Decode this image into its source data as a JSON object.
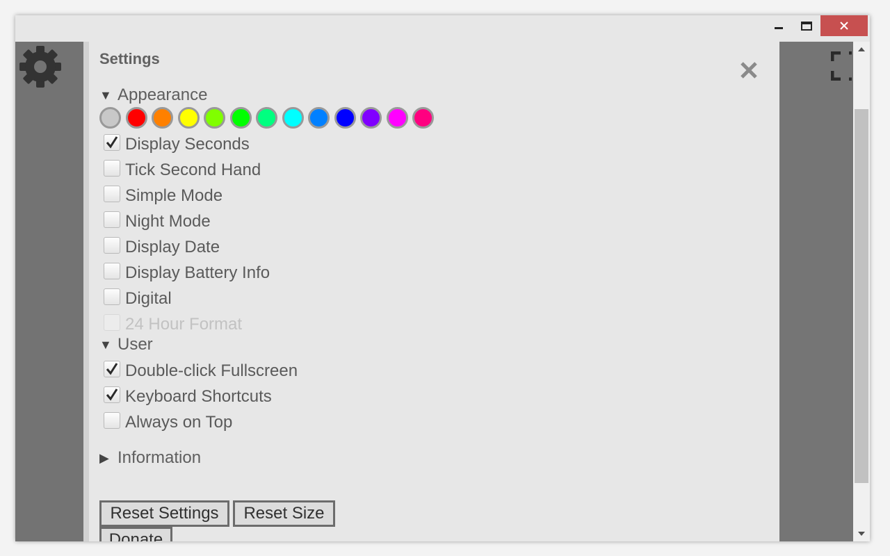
{
  "window": {
    "buttons": {
      "minimize": "minimize-icon",
      "maximize": "maximize-icon",
      "close": "close-icon"
    }
  },
  "settings": {
    "title": "Settings",
    "appearance": {
      "heading": "Appearance",
      "swatches": [
        "#c8c8c8",
        "#ff0000",
        "#ff8000",
        "#ffff00",
        "#80ff00",
        "#00ff00",
        "#00ff80",
        "#00ffff",
        "#0080ff",
        "#0000ff",
        "#8000ff",
        "#ff00ff",
        "#ff0080"
      ],
      "options": [
        {
          "label": "Display Seconds",
          "checked": true
        },
        {
          "label": "Tick Second Hand",
          "checked": false
        },
        {
          "label": "Simple Mode",
          "checked": false
        },
        {
          "label": "Night Mode",
          "checked": false
        },
        {
          "label": "Display Date",
          "checked": false
        },
        {
          "label": "Display Battery Info",
          "checked": false
        },
        {
          "label": "Digital",
          "checked": false
        },
        {
          "label": "24 Hour Format",
          "checked": false,
          "disabled": true
        }
      ]
    },
    "user": {
      "heading": "User",
      "options": [
        {
          "label": "Double-click Fullscreen",
          "checked": true
        },
        {
          "label": "Keyboard Shortcuts",
          "checked": true
        },
        {
          "label": "Always on Top",
          "checked": false
        }
      ]
    },
    "information": {
      "heading": "Information"
    },
    "buttons": {
      "reset_settings": "Reset Settings",
      "reset_size": "Reset Size",
      "donate": "Donate"
    }
  },
  "colors": {
    "panel": "#737373",
    "close_button": "#c75050"
  }
}
